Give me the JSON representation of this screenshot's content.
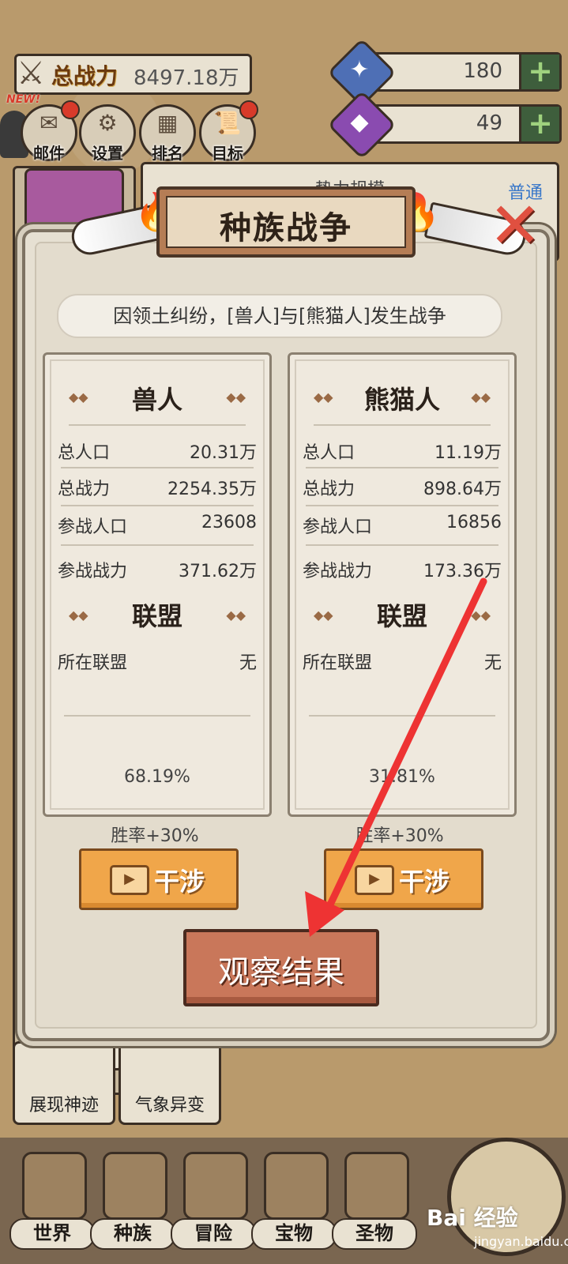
{
  "header": {
    "power_label": "总战力",
    "power_value": "8497.18万",
    "new_badge": "NEW!",
    "resource1_value": "180",
    "resource2_value": "49",
    "plus": "+"
  },
  "menu": [
    {
      "label": "邮件"
    },
    {
      "label": "设置"
    },
    {
      "label": "排名"
    },
    {
      "label": "目标"
    }
  ],
  "background": {
    "panel_title": "势力规模",
    "panel_tab": "普通",
    "bottom_cards": [
      "展现神迹",
      "气象异变"
    ]
  },
  "modal": {
    "title": "种族战争",
    "subtitle": "因领土纠纷，[兽人]与[熊猫人]发生战争",
    "left": {
      "race": "兽人",
      "rows": [
        {
          "label": "总人口",
          "value": "20.31万"
        },
        {
          "label": "总战力",
          "value": "2254.35万"
        },
        {
          "label": "参战人口",
          "value": "23608"
        },
        {
          "label": "参战战力",
          "value": "371.62万"
        }
      ],
      "alliance_title": "联盟",
      "alliance_label": "所在联盟",
      "alliance_value": "无",
      "percent": "68.19%",
      "winrate": "胜率+30%",
      "interfere": "干涉"
    },
    "right": {
      "race": "熊猫人",
      "rows": [
        {
          "label": "总人口",
          "value": "11.19万"
        },
        {
          "label": "总战力",
          "value": "898.64万"
        },
        {
          "label": "参战人口",
          "value": "16856"
        },
        {
          "label": "参战战力",
          "value": "173.36万"
        }
      ],
      "alliance_title": "联盟",
      "alliance_label": "所在联盟",
      "alliance_value": "无",
      "percent": "31.81%",
      "winrate": "胜率+30%",
      "interfere": "干涉"
    },
    "observe_button": "观察结果"
  },
  "bottom_nav": [
    {
      "label": "世界"
    },
    {
      "label": "种族"
    },
    {
      "label": "冒险"
    },
    {
      "label": "宝物"
    },
    {
      "label": "圣物"
    }
  ],
  "watermark": {
    "main": "Bai 经验",
    "sub": "jingyan.baidu.com"
  },
  "colors": {
    "accent": "#f0a64a",
    "close": "#e05040",
    "arrow": "#ee3333",
    "link": "#3a78c9"
  }
}
